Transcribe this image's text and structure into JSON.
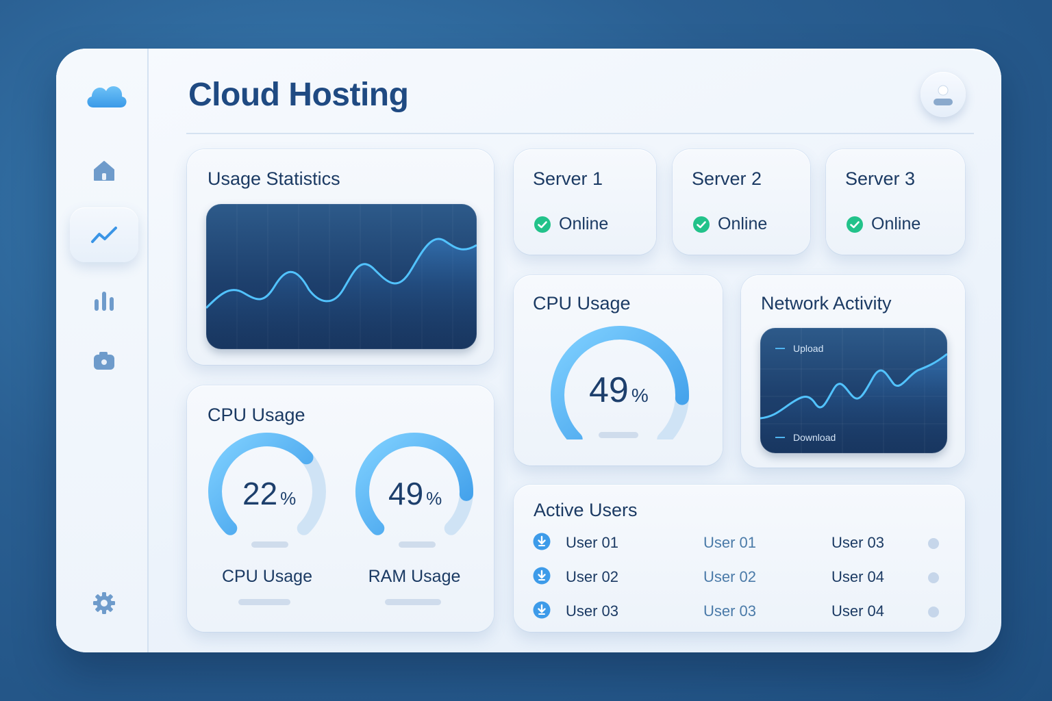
{
  "app": {
    "title": "Cloud Hosting"
  },
  "sidebar": {
    "items": [
      {
        "icon": "home-icon",
        "active": false
      },
      {
        "icon": "analytics-icon",
        "active": true
      },
      {
        "icon": "bar-chart-icon",
        "active": false
      },
      {
        "icon": "camera-icon",
        "active": false
      },
      {
        "icon": "gear-icon",
        "active": false
      }
    ]
  },
  "usage_statistics": {
    "title": "Usage Statistics"
  },
  "servers": [
    {
      "name": "Server 1",
      "status": "Online"
    },
    {
      "name": "Server 2",
      "status": "Online"
    },
    {
      "name": "Server 3",
      "status": "Online"
    }
  ],
  "cpu_usage_card": {
    "title": "CPU Usage",
    "value": "49",
    "unit": "%",
    "fraction": 0.49
  },
  "network_activity": {
    "title": "Network Activity",
    "legend_upload": "Upload",
    "legend_download": "Download"
  },
  "resource_card": {
    "title": "CPU Usage",
    "gauges": [
      {
        "label": "CPU Usage",
        "value": "22",
        "unit": "%",
        "fraction": 0.22
      },
      {
        "label": "RAM Usage",
        "value": "49",
        "unit": "%",
        "fraction": 0.49
      }
    ]
  },
  "active_users": {
    "title": "Active Users",
    "rows": [
      {
        "col1": "User 01",
        "col2": "User 01",
        "col3": "User 03"
      },
      {
        "col1": "User 02",
        "col2": "User 02",
        "col3": "User 04"
      },
      {
        "col1": "User 03",
        "col2": "User 03",
        "col3": "User 04"
      }
    ]
  },
  "colors": {
    "accent": "#4fb4f0",
    "online": "#22c28a",
    "title": "#1f4a82",
    "background": "#2a5f92"
  }
}
